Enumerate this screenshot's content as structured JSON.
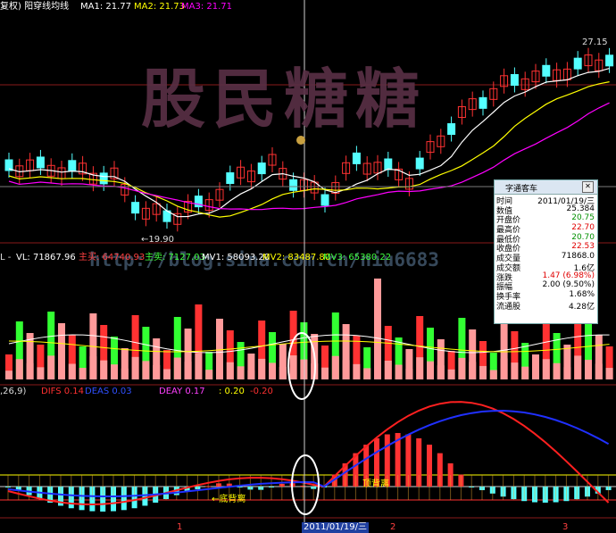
{
  "colors": {
    "up": "#ff3232",
    "down": "#54ffff",
    "vol_up": "#ff3232",
    "vol_down": "#32ff32",
    "vol_pink": "#ff9a9a",
    "ma1": "#ffffff",
    "ma2": "#ffff00",
    "ma3": "#ff00ff",
    "dif": "#ff2020",
    "dea": "#2030ff"
  },
  "header": {
    "title": "复权) 阳穿线均线",
    "ma1": "MA1: 21.77",
    "ma2": "MA2: 21.73",
    "ma3": "MA3: 21.71"
  },
  "price": {
    "high_label": "27.15",
    "low_label": "←19.90"
  },
  "volume_header": {
    "prefix": "L -",
    "vl": "VL: 71867.96",
    "zhumai": "主买: 64740.93",
    "zhumai2": "主卖: 7127.03",
    "mv1": "MV1: 58093.20",
    "mv2": "MV2: 83487.80",
    "mv3": "MV3: 65380.22"
  },
  "watermark": {
    "main": "股民糖糖",
    "blog": "http://blog.sina.com.cn/niu6683"
  },
  "macd_header": {
    "param": ",26,9)",
    "dif": "DIFS 0.14",
    "dea": "DEAS 0.03",
    "deay": "DEAY 0.17",
    "v1": ": 0.20",
    "v2": "-0.20"
  },
  "annotations": {
    "bottom_div": "←底背离",
    "top_div": "顶背离"
  },
  "xaxis": {
    "cursor_date": "2011/01/19/三",
    "ticks": [
      "1",
      "2",
      "3"
    ]
  },
  "tooltip": {
    "title": "字通客车",
    "rows": [
      {
        "k": "时间",
        "v": "2011/01/19/三",
        "c": "#000"
      },
      {
        "k": "数值",
        "v": "25.384",
        "c": "#000"
      },
      {
        "k": "开盘价",
        "v": "20.75",
        "c": "#009000"
      },
      {
        "k": "最高价",
        "v": "22.70",
        "c": "#e00000"
      },
      {
        "k": "最低价",
        "v": "20.70",
        "c": "#009000"
      },
      {
        "k": "收盘价",
        "v": "22.53",
        "c": "#e00000"
      },
      {
        "k": "成交量",
        "v": "71868.0",
        "c": "#000"
      },
      {
        "k": "成交额",
        "v": "1.6亿",
        "c": "#000"
      },
      {
        "k": "涨跌",
        "v": "1.47 (6.98%)",
        "c": "#e00000"
      },
      {
        "k": "振幅",
        "v": "2.00 (9.50%)",
        "c": "#000"
      },
      {
        "k": "换手率",
        "v": "1.68%",
        "c": "#000"
      },
      {
        "k": "流通股",
        "v": "4.28亿",
        "c": "#000"
      }
    ]
  }
}
